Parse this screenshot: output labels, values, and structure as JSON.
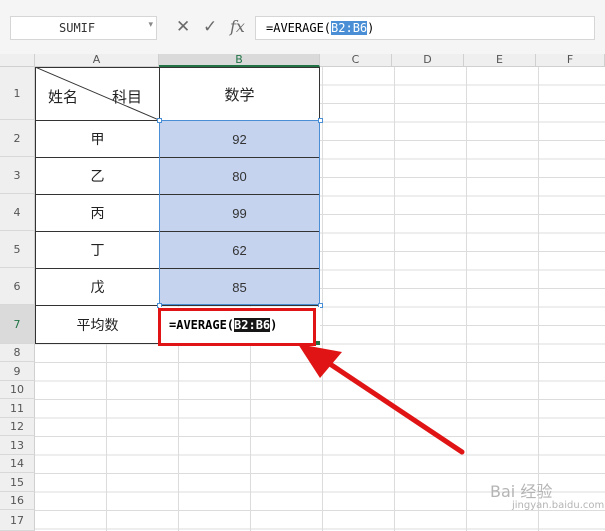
{
  "formula_bar": {
    "name_box": "SUMIF",
    "cancel_symbol": "✕",
    "confirm_symbol": "✓",
    "fx_symbol": "fx",
    "formula_prefix": "=AVERAGE(",
    "formula_ref": "B2:B6",
    "formula_suffix": ")"
  },
  "columns": [
    "A",
    "B",
    "C",
    "D",
    "E",
    "F"
  ],
  "rows": [
    "1",
    "2",
    "3",
    "4",
    "5",
    "6",
    "7",
    "8",
    "9",
    "10",
    "11",
    "12",
    "13",
    "14",
    "15",
    "16",
    "17"
  ],
  "table": {
    "header_name": "姓名",
    "header_subject": "科目",
    "header_math": "数学",
    "names": [
      "甲",
      "乙",
      "丙",
      "丁",
      "戊"
    ],
    "scores": [
      "92",
      "80",
      "99",
      "62",
      "85"
    ],
    "average_label": "平均数"
  },
  "edit_cell": {
    "prefix": "=AVERAGE(",
    "ref": "B2:B6",
    "suffix": ")"
  },
  "colors": {
    "selection_fill": "#c5d3ef",
    "selection_border": "#4a8fd6",
    "annotation_red": "#e01414",
    "active_header": "#217346"
  },
  "watermark": {
    "main": "Bai 经验",
    "sub": "jingyan.baidu.com"
  }
}
